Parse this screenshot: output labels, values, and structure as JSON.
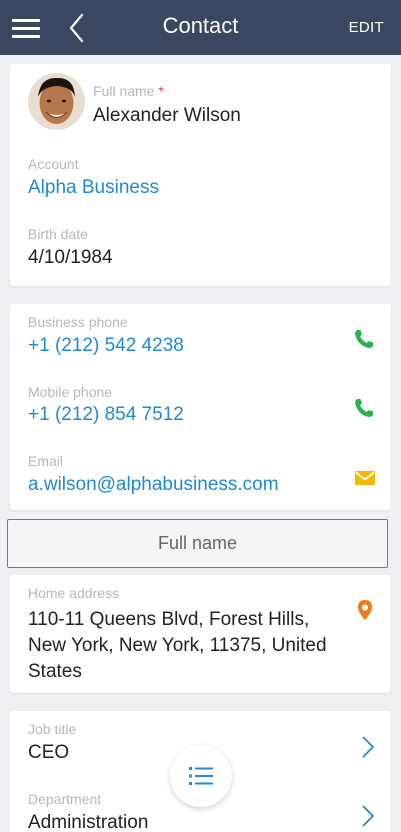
{
  "header": {
    "title": "Contact",
    "edit_label": "EDIT"
  },
  "profile": {
    "full_name_label": "Full name",
    "required_mark": "*",
    "full_name": "Alexander Wilson",
    "account_label": "Account",
    "account": "Alpha Business",
    "birth_date_label": "Birth date",
    "birth_date": "4/10/1984"
  },
  "communications": {
    "business_phone_label": "Business phone",
    "business_phone": "+1 (212) 542 4238",
    "mobile_phone_label": "Mobile phone",
    "mobile_phone": "+1 (212) 854 7512",
    "email_label": "Email",
    "email": "a.wilson@alphabusiness.com"
  },
  "fullname_button": {
    "label": "Full name"
  },
  "address": {
    "label": "Home address",
    "value": "110-11 Queens Blvd, Forest Hills, New York, New York, 11375, United States"
  },
  "job": {
    "job_title_label": "Job title",
    "job_title": "CEO",
    "department_label": "Department",
    "department": "Administration"
  },
  "colors": {
    "header_bg": "#3b4760",
    "link": "#1f8ad3",
    "phone_icon": "#2bb24c",
    "email_icon": "#f5b800",
    "map_icon": "#f07d1a",
    "highlight_border": "#e24a55"
  },
  "icons": {
    "menu": "hamburger-menu-icon",
    "back": "back-arrow-icon",
    "phone": "phone-icon",
    "email": "envelope-icon",
    "map": "map-pin-icon",
    "chevron": "chevron-right-icon",
    "fab": "list-icon"
  }
}
